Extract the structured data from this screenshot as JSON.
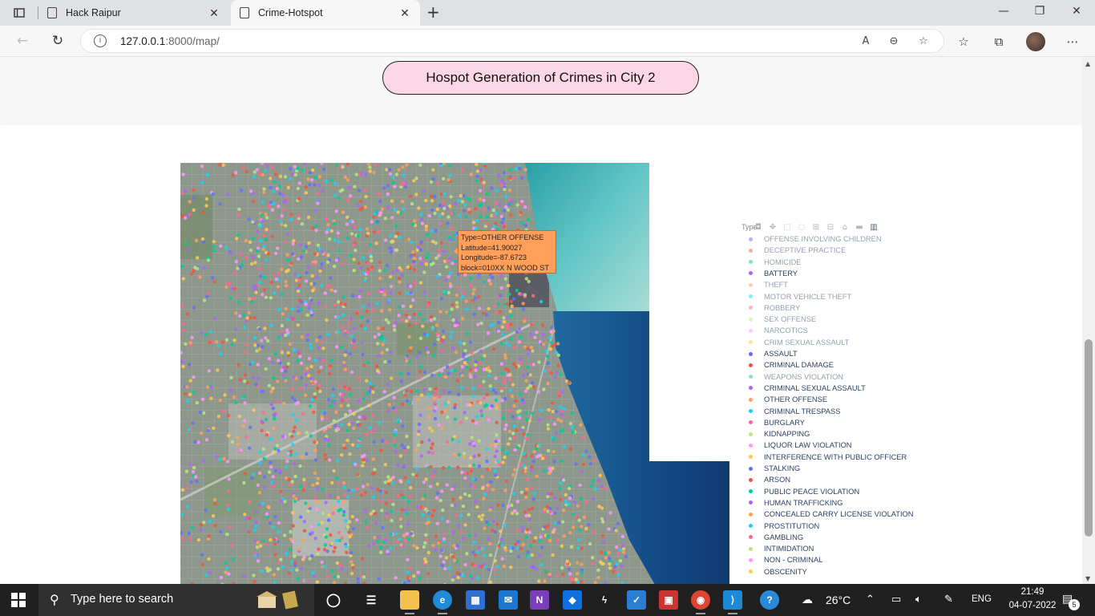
{
  "browser": {
    "tabs": [
      {
        "title": "Hack Raipur",
        "active": false
      },
      {
        "title": "Crime-Hotspot",
        "active": true
      }
    ],
    "url_host": "127.0.0.1",
    "url_path": ":8000/map/"
  },
  "page": {
    "heading": "Hospot Generation of Crimes in City 2"
  },
  "tooltip": {
    "line1": "Type=OTHER OFFENSE",
    "line2": "Latitude=41.90027",
    "line3": "Longitude=-87.6723",
    "line4": "block=010XX N WOOD ST"
  },
  "legend": {
    "title": "Type",
    "items": [
      {
        "label": "OFFENSE INVOLVING CHILDREN",
        "color": "#636efa",
        "visible": false
      },
      {
        "label": "DECEPTIVE PRACTICE",
        "color": "#ef553b",
        "visible": false
      },
      {
        "label": "HOMICIDE",
        "color": "#00cc96",
        "visible": false
      },
      {
        "label": "BATTERY",
        "color": "#ab63fa",
        "visible": true
      },
      {
        "label": "THEFT",
        "color": "#ffa15a",
        "visible": false
      },
      {
        "label": "MOTOR VEHICLE THEFT",
        "color": "#19d3f3",
        "visible": false
      },
      {
        "label": "ROBBERY",
        "color": "#ff6692",
        "visible": false
      },
      {
        "label": "SEX OFFENSE",
        "color": "#b6e880",
        "visible": false
      },
      {
        "label": "NARCOTICS",
        "color": "#ff97ff",
        "visible": false
      },
      {
        "label": "CRIM SEXUAL ASSAULT",
        "color": "#fecb52",
        "visible": false
      },
      {
        "label": "ASSAULT",
        "color": "#636efa",
        "visible": true
      },
      {
        "label": "CRIMINAL DAMAGE",
        "color": "#ef553b",
        "visible": true
      },
      {
        "label": "WEAPONS VIOLATION",
        "color": "#00cc96",
        "visible": false
      },
      {
        "label": "CRIMINAL SEXUAL ASSAULT",
        "color": "#ab63fa",
        "visible": true
      },
      {
        "label": "OTHER OFFENSE",
        "color": "#ffa15a",
        "visible": true
      },
      {
        "label": "CRIMINAL TRESPASS",
        "color": "#19d3f3",
        "visible": true
      },
      {
        "label": "BURGLARY",
        "color": "#ff6692",
        "visible": true
      },
      {
        "label": "KIDNAPPING",
        "color": "#b6e880",
        "visible": true
      },
      {
        "label": "LIQUOR LAW VIOLATION",
        "color": "#ff97ff",
        "visible": true
      },
      {
        "label": "INTERFERENCE WITH PUBLIC OFFICER",
        "color": "#fecb52",
        "visible": true
      },
      {
        "label": "STALKING",
        "color": "#636efa",
        "visible": true
      },
      {
        "label": "ARSON",
        "color": "#ef553b",
        "visible": true
      },
      {
        "label": "PUBLIC PEACE VIOLATION",
        "color": "#00cc96",
        "visible": true
      },
      {
        "label": "HUMAN TRAFFICKING",
        "color": "#ab63fa",
        "visible": true
      },
      {
        "label": "CONCEALED CARRY LICENSE VIOLATION",
        "color": "#ffa15a",
        "visible": true
      },
      {
        "label": "PROSTITUTION",
        "color": "#19d3f3",
        "visible": true
      },
      {
        "label": "GAMBLING",
        "color": "#ff6692",
        "visible": true
      },
      {
        "label": "INTIMIDATION",
        "color": "#b6e880",
        "visible": true
      },
      {
        "label": "NON - CRIMINAL",
        "color": "#ff97ff",
        "visible": true
      },
      {
        "label": "OBSCENITY",
        "color": "#fecb52",
        "visible": true
      }
    ]
  },
  "map_points": {
    "seed": 7,
    "count": 2600,
    "palette": [
      "#ab63fa",
      "#636efa",
      "#ef553b",
      "#ffa15a",
      "#19d3f3",
      "#ff6692",
      "#00cc96",
      "#ff97ff",
      "#b6e880",
      "#fecb52"
    ]
  },
  "taskbar": {
    "search_placeholder": "Type here to search",
    "temperature": "26°C",
    "language": "ENG",
    "time": "21:49",
    "date": "04-07-2022",
    "notifications": "5"
  }
}
